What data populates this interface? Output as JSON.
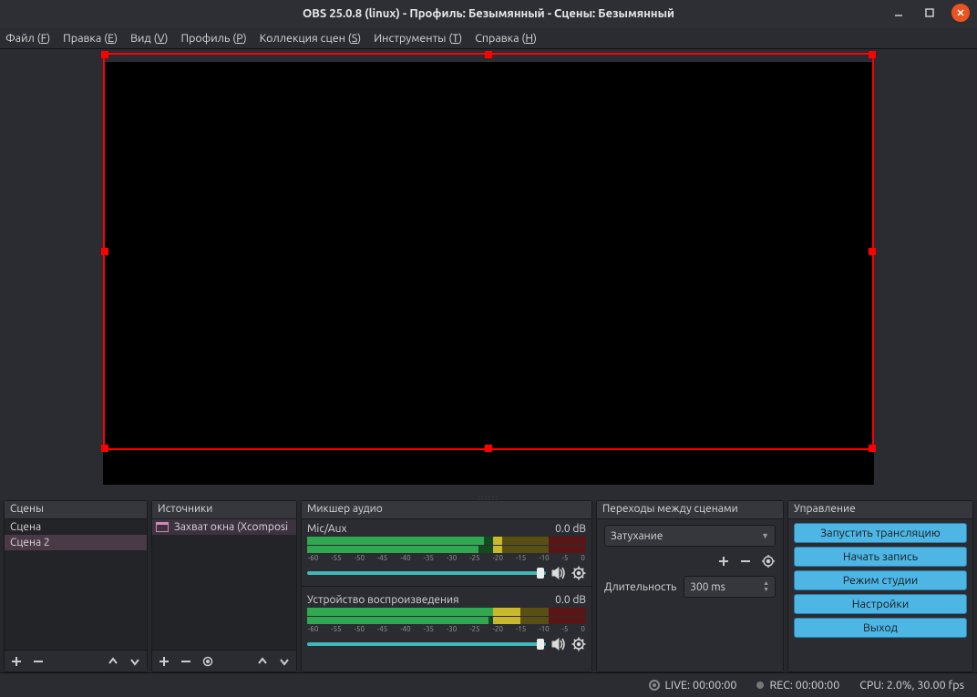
{
  "window": {
    "title": "OBS 25.0.8 (linux) - Профиль: Безымянный - Сцены: Безымянный"
  },
  "menu": {
    "file": "Файл",
    "file_k": "F",
    "edit": "Правка",
    "edit_k": "E",
    "view": "Вид",
    "view_k": "V",
    "profile": "Профиль",
    "profile_k": "P",
    "scenes": "Коллекция сцен",
    "scenes_k": "S",
    "tools": "Инструменты",
    "tools_k": "T",
    "help": "Справка",
    "help_k": "H"
  },
  "docks": {
    "scenes": {
      "title": "Сцены",
      "items": [
        "Сцена",
        "Сцена 2"
      ],
      "selected": 1
    },
    "sources": {
      "title": "Источники",
      "items": [
        "Захват окна (Xcomposi"
      ]
    },
    "mixer": {
      "title": "Микшер аудио",
      "channels": [
        {
          "name": "Mic/Aux",
          "db": "0.0 dB"
        },
        {
          "name": "Устройство воспроизведения",
          "db": "0.0 dB"
        }
      ],
      "ticks": [
        "-60",
        "-55",
        "-50",
        "-45",
        "-40",
        "-35",
        "-30",
        "-25",
        "-20",
        "-15",
        "-10",
        "-5",
        "0"
      ]
    },
    "transitions": {
      "title": "Переходы между сценами",
      "current": "Затухание",
      "duration_label": "Длительность",
      "duration_value": "300 ms"
    },
    "controls": {
      "title": "Управление",
      "buttons": [
        "Запустить трансляцию",
        "Начать запись",
        "Режим студии",
        "Настройки",
        "Выход"
      ]
    }
  },
  "status": {
    "live": "LIVE: 00:00:00",
    "rec": "REC: 00:00:00",
    "cpu": "CPU: 2.0%, 30.00 fps"
  }
}
